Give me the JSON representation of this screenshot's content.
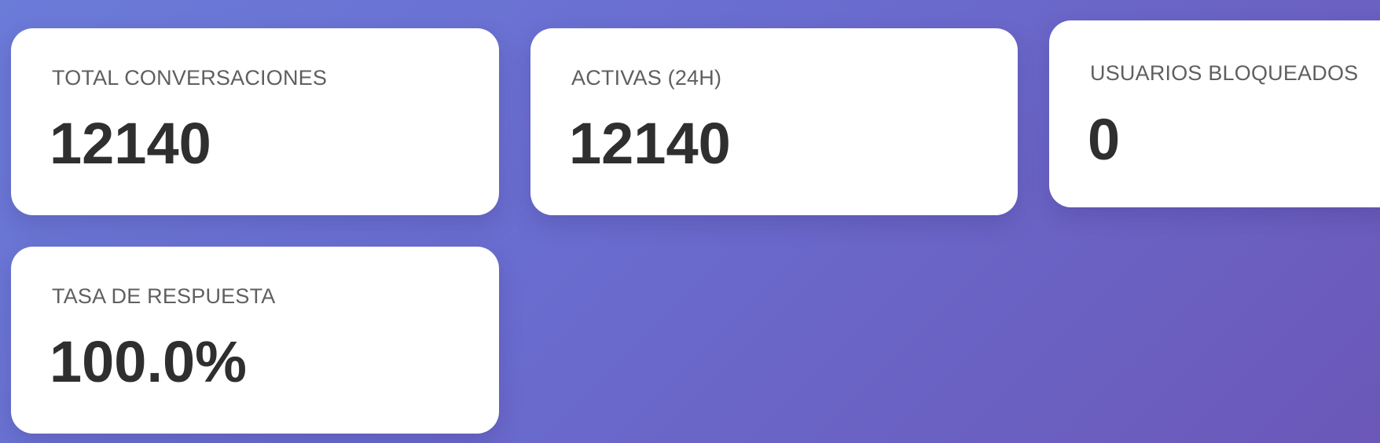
{
  "stats": [
    {
      "label": "TOTAL CONVERSACIONES",
      "value": "12140"
    },
    {
      "label": "ACTIVAS (24H)",
      "value": "12140"
    },
    {
      "label": "USUARIOS BLOQUEADOS",
      "value": "0"
    },
    {
      "label": "TASA DE RESPUESTA",
      "value": "100.0%"
    }
  ],
  "colors": {
    "background_start": "#6b7bd8",
    "background_end": "#6b58b8",
    "card_background": "#ffffff",
    "label_text": "#5f5f5f",
    "value_text": "#2f2f2f"
  }
}
